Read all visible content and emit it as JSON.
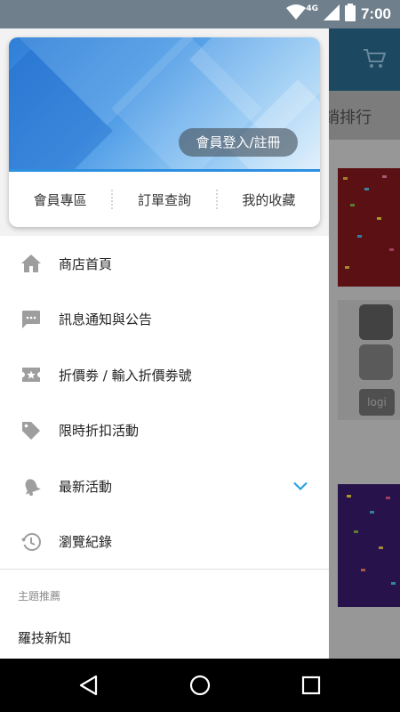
{
  "status_bar": {
    "network": "4G",
    "time": "7:00"
  },
  "background": {
    "tab_text": "銷排行"
  },
  "drawer": {
    "login_button": "會員登入/註冊",
    "links": [
      "會員專區",
      "訂單查詢",
      "我的收藏"
    ],
    "menu_items": [
      {
        "label": "商店首頁",
        "icon": "home-icon"
      },
      {
        "label": "訊息通知與公告",
        "icon": "message-icon"
      },
      {
        "label": "折價劵 / 輸入折價劵號",
        "icon": "coupon-icon"
      },
      {
        "label": "限時折扣活動",
        "icon": "tag-icon"
      },
      {
        "label": "最新活動",
        "icon": "bell-icon"
      },
      {
        "label": "瀏覽紀錄",
        "icon": "history-icon"
      }
    ],
    "section_title": "主題推薦",
    "section_item": "羅技新知"
  },
  "colors": {
    "accent": "#2d8fe0",
    "chevron": "#29a3e0",
    "icon": "#9e9e9e"
  },
  "product_logo": "logi"
}
